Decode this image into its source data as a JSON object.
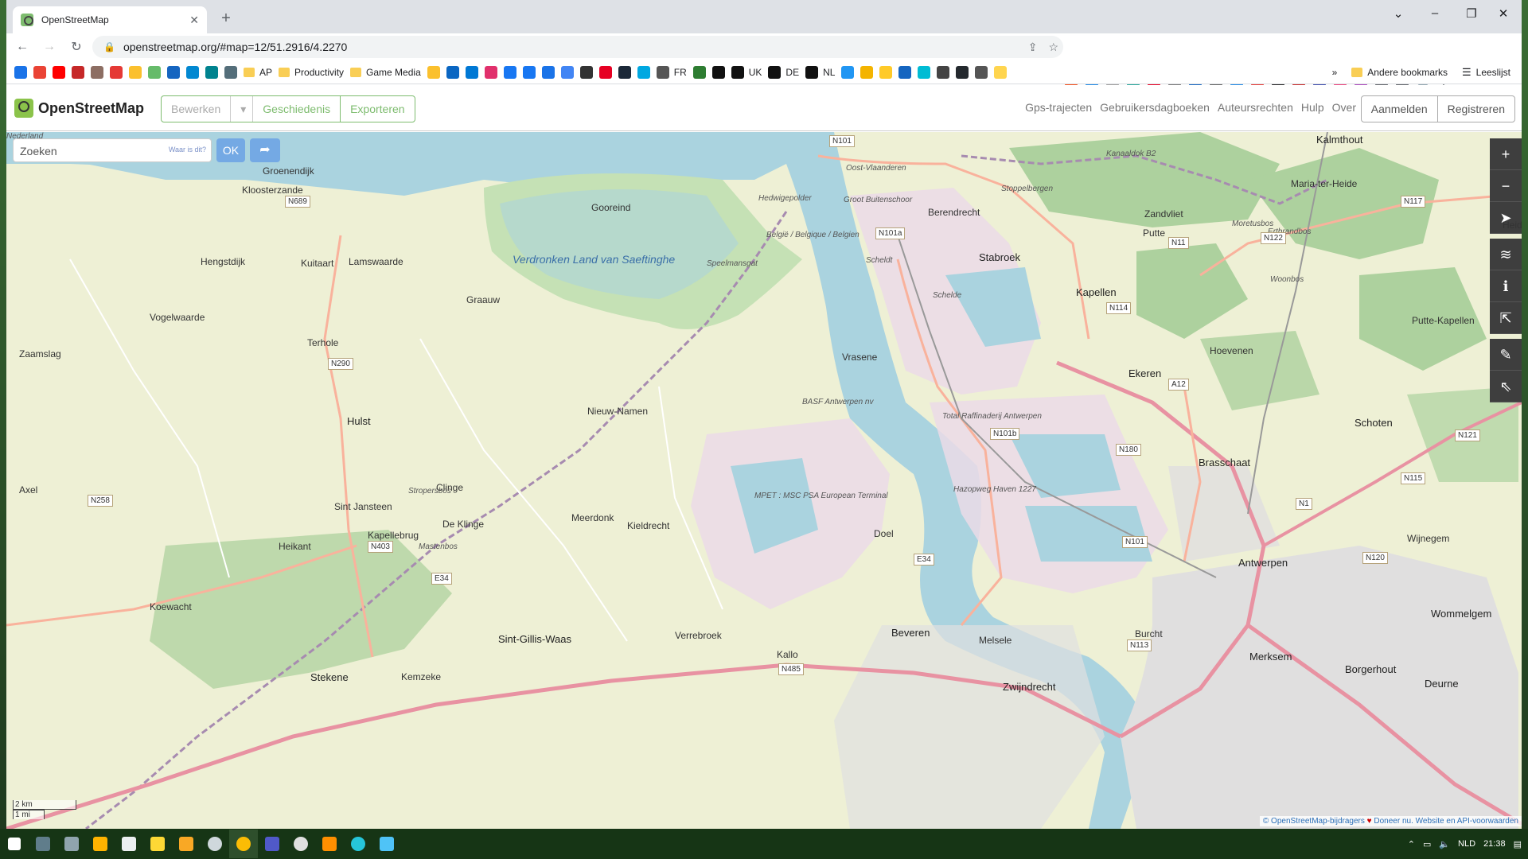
{
  "browser": {
    "tab_title": "OpenStreetMap",
    "url": "openstreetmap.org/#map=12/51.2916/4.2270"
  },
  "bookmarks": [
    {
      "label": "",
      "color": "#1a73e8"
    },
    {
      "label": "",
      "color": "#ea4335"
    },
    {
      "label": "",
      "color": "#ff0000"
    },
    {
      "label": "",
      "color": "#c62828"
    },
    {
      "label": "",
      "color": "#8d6e63"
    },
    {
      "label": "",
      "color": "#e53935"
    },
    {
      "label": "",
      "color": "#fbc02d"
    },
    {
      "label": "",
      "color": "#66bb6a"
    },
    {
      "label": "",
      "color": "#1565c0"
    },
    {
      "label": "",
      "color": "#0288d1"
    },
    {
      "label": "",
      "color": "#00838f"
    },
    {
      "label": "",
      "color": "#546e7a"
    },
    {
      "label": "AP",
      "folder": true
    },
    {
      "label": "Productivity",
      "folder": true
    },
    {
      "label": "Game Media",
      "folder": true
    },
    {
      "label": "",
      "color": "#fbc02d"
    },
    {
      "label": "",
      "color": "#0a66c2"
    },
    {
      "label": "",
      "color": "#0078d4"
    },
    {
      "label": "",
      "color": "#e1306c"
    },
    {
      "label": "",
      "color": "#1877f2"
    },
    {
      "label": "",
      "color": "#1877f2"
    },
    {
      "label": "",
      "color": "#1a73e8"
    },
    {
      "label": "",
      "color": "#4285f4"
    },
    {
      "label": "",
      "color": "#333333"
    },
    {
      "label": "",
      "color": "#e60023"
    },
    {
      "label": "",
      "color": "#1b2838"
    },
    {
      "label": "",
      "color": "#00a8e1"
    },
    {
      "label": "FR",
      "color": "#555555"
    },
    {
      "label": "",
      "color": "#2e7d32"
    },
    {
      "label": "",
      "color": "#111111"
    },
    {
      "label": "UK",
      "color": "#111111"
    },
    {
      "label": "DE",
      "color": "#111111"
    },
    {
      "label": "NL",
      "color": "#111111"
    },
    {
      "label": "",
      "color": "#2196f3"
    },
    {
      "label": "",
      "color": "#f4b400"
    },
    {
      "label": "",
      "color": "#ffca28"
    },
    {
      "label": "",
      "color": "#1565c0"
    },
    {
      "label": "",
      "color": "#00bcd4"
    },
    {
      "label": "",
      "color": "#444444"
    },
    {
      "label": "",
      "color": "#24292e"
    },
    {
      "label": "",
      "color": "#555555"
    },
    {
      "label": "",
      "color": "#ffd54f"
    }
  ],
  "bookmarks_right": {
    "more": "»",
    "other": "Andere bookmarks",
    "reading": "Leeslijst"
  },
  "osm": {
    "logo": "OpenStreetMap",
    "edit": "Bewerken",
    "history": "Geschiedenis",
    "export": "Exporteren",
    "nav": [
      "Gps-trajecten",
      "Gebruikersdagboeken",
      "Auteursrechten",
      "Hulp",
      "Over"
    ],
    "login": "Aanmelden",
    "register": "Registreren"
  },
  "search": {
    "placeholder": "Zoeken",
    "where": "Waar is dit?",
    "ok": "OK"
  },
  "map": {
    "places": [
      {
        "t": "Kalmthout",
        "big": true
      },
      {
        "t": "Groenendijk"
      },
      {
        "t": "Kloosterzande"
      },
      {
        "t": "Hengstdijk"
      },
      {
        "t": "Kuitaart"
      },
      {
        "t": "Lamswaarde"
      },
      {
        "t": "Vogelwaarde"
      },
      {
        "t": "Terhole"
      },
      {
        "t": "Zaamslag"
      },
      {
        "t": "Graauw"
      },
      {
        "t": "Hulst",
        "big": true
      },
      {
        "t": "Axel"
      },
      {
        "t": "Sint Jansteen"
      },
      {
        "t": "Kapellebrug"
      },
      {
        "t": "Heikant"
      },
      {
        "t": "Koewacht"
      },
      {
        "t": "Stekene",
        "big": true
      },
      {
        "t": "Kemzeke"
      },
      {
        "t": "Sint-Gillis-Waas",
        "big": true
      },
      {
        "t": "Clinge"
      },
      {
        "t": "De Klinge"
      },
      {
        "t": "Meerdonk"
      },
      {
        "t": "Nieuw-Namen"
      },
      {
        "t": "Kieldrecht"
      },
      {
        "t": "Verrebroek"
      },
      {
        "t": "Vrasene"
      },
      {
        "t": "Doel"
      },
      {
        "t": "Kallo"
      },
      {
        "t": "Beveren",
        "big": true
      },
      {
        "t": "Melsele"
      },
      {
        "t": "Zwijndrecht",
        "big": true
      },
      {
        "t": "Burcht"
      },
      {
        "t": "Antwerpen",
        "big": true
      },
      {
        "t": "Merksem",
        "big": true
      },
      {
        "t": "Borgerhout",
        "big": true
      },
      {
        "t": "Deurne",
        "big": true
      },
      {
        "t": "Wommelgem",
        "big": true
      },
      {
        "t": "Wijnegem"
      },
      {
        "t": "Schoten",
        "big": true
      },
      {
        "t": "Brasschaat",
        "big": true
      },
      {
        "t": "Ekeren",
        "big": true
      },
      {
        "t": "Hoevenen"
      },
      {
        "t": "Kapellen",
        "big": true
      },
      {
        "t": "Stabroek",
        "big": true
      },
      {
        "t": "Berendrecht"
      },
      {
        "t": "Zandvliet"
      },
      {
        "t": "Putte"
      },
      {
        "t": "Putte-Kapellen"
      },
      {
        "t": "Maria-ter-Heide"
      },
      {
        "t": "Heide"
      },
      {
        "t": "Gooreind"
      },
      {
        "t": "Verdronken Land van Saeftinghe",
        "water": true
      },
      {
        "t": "Speelmansgat",
        "small": true
      },
      {
        "t": "Hedwigepolder",
        "small": true
      },
      {
        "t": "Groot Buitenschoor",
        "small": true
      },
      {
        "t": "BASF Antwerpen nv",
        "small": true
      },
      {
        "t": "MPET : MSC PSA European Terminal",
        "small": true
      },
      {
        "t": "Hazopweg Haven 1227",
        "small": true
      },
      {
        "t": "Total Raffinaderij Antwerpen",
        "small": true
      },
      {
        "t": "Scheldt",
        "small": true
      },
      {
        "t": "Schelde",
        "small": true
      },
      {
        "t": "Kanaaldok B2",
        "small": true
      },
      {
        "t": "Stoppelbergen",
        "small": true
      },
      {
        "t": "Moretusbos",
        "small": true
      },
      {
        "t": "Ertbrandbos",
        "small": true
      },
      {
        "t": "Woonbos",
        "small": true
      },
      {
        "t": "Mastenbos",
        "small": true
      },
      {
        "t": "Stropersbos",
        "small": true
      },
      {
        "t": "Oost-Vlaanderen",
        "small": true
      },
      {
        "t": "België / Belgique / Belgien",
        "small": true
      },
      {
        "t": "Nederland",
        "small": true
      }
    ],
    "roads": [
      "N689",
      "N290",
      "N258",
      "N403",
      "E34",
      "E34",
      "N101",
      "N101a",
      "N101b",
      "N180",
      "N114",
      "N11",
      "N122",
      "N117",
      "A12",
      "N1",
      "N115",
      "N121",
      "N120",
      "N113",
      "N101",
      "N485"
    ],
    "scale_km": "2 km",
    "scale_mi": "1 mi",
    "attribution_osm": "© OpenStreetMap-bijdragers",
    "attribution_heart": "♥",
    "attribution_donate": "Doneer nu.",
    "attribution_api": "Website en API-voorwaarden"
  },
  "taskbar": {
    "lang": "NLD",
    "time": "21:38"
  },
  "colors": {
    "water": "#aad3df",
    "farmland": "#eef0d5",
    "forest": "#add19e",
    "wetland": "#c5e1b5",
    "industrial": "#ebdbe8",
    "motorway": "#e892a2",
    "trunk": "#f9b29c"
  }
}
